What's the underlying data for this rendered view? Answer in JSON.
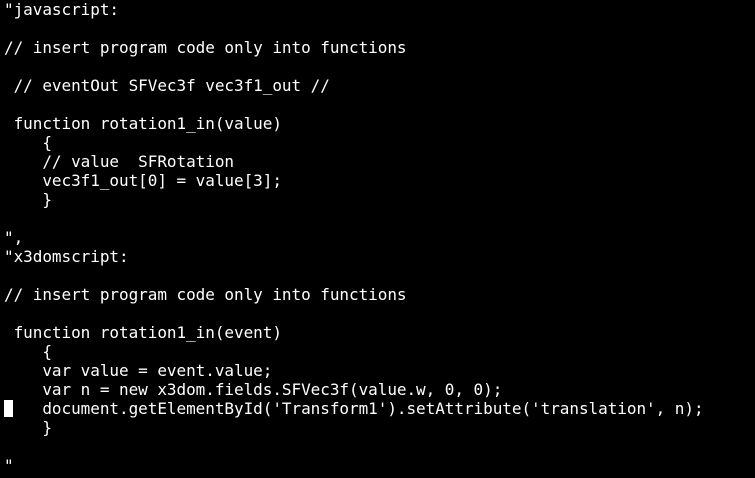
{
  "terminal": {
    "lines": [
      "\"javascript:",
      "",
      "// insert program code only into functions",
      "",
      " // eventOut SFVec3f vec3f1_out //",
      "",
      " function rotation1_in(value)",
      "    {",
      "    // value  SFRotation",
      "    vec3f1_out[0] = value[3];",
      "    }",
      "",
      "\",",
      "\"x3domscript:",
      "",
      "// insert program code only into functions",
      "",
      " function rotation1_in(event)",
      "    {",
      "    var value = event.value;",
      "    var n = new x3dom.fields.SFVec3f(value.w, 0, 0);",
      "    document.getElementById('Transform1').setAttribute('translation', n);",
      "    }",
      "",
      "\""
    ]
  },
  "colors": {
    "background": "#000000",
    "text": "#ffffff",
    "cursor": "#ffffff"
  }
}
